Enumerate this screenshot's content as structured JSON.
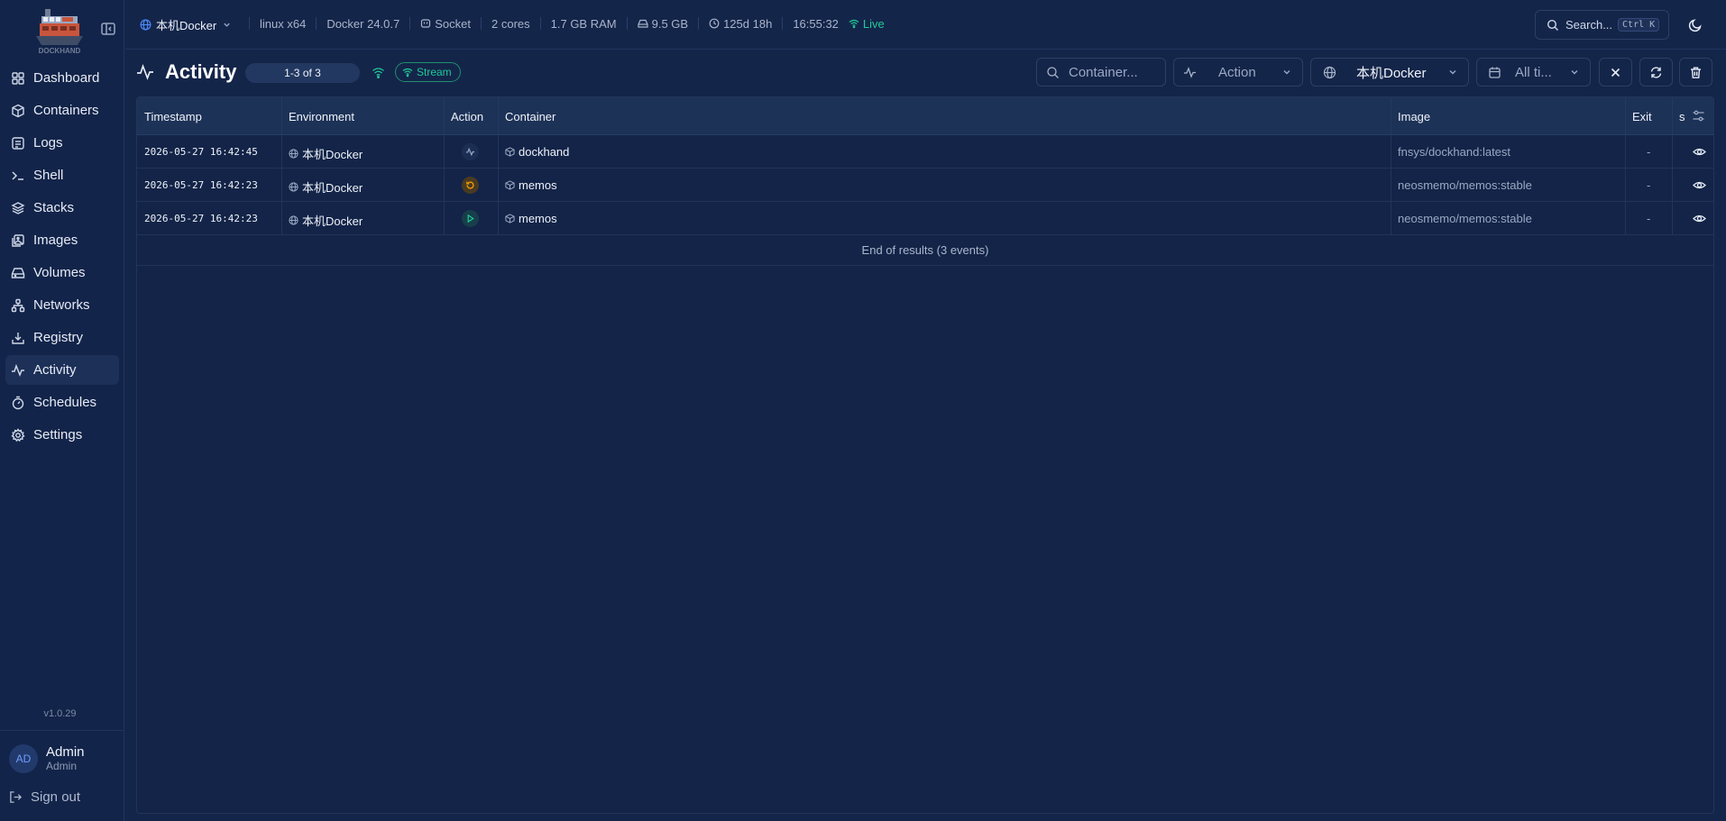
{
  "app": {
    "logo_text": "DOCKHAND",
    "version": "v1.0.29"
  },
  "sidebar": {
    "items": [
      {
        "label": "Dashboard",
        "icon": "dashboard-icon"
      },
      {
        "label": "Containers",
        "icon": "box-icon"
      },
      {
        "label": "Logs",
        "icon": "logs-icon"
      },
      {
        "label": "Shell",
        "icon": "terminal-icon"
      },
      {
        "label": "Stacks",
        "icon": "layers-icon"
      },
      {
        "label": "Images",
        "icon": "images-icon"
      },
      {
        "label": "Volumes",
        "icon": "hard-drive-icon"
      },
      {
        "label": "Networks",
        "icon": "network-icon"
      },
      {
        "label": "Registry",
        "icon": "download-icon"
      },
      {
        "label": "Activity",
        "icon": "activity-icon",
        "active": true
      },
      {
        "label": "Schedules",
        "icon": "timer-icon"
      },
      {
        "label": "Settings",
        "icon": "gear-icon"
      }
    ],
    "user": {
      "initials": "AD",
      "name": "Admin",
      "role": "Admin"
    },
    "signout_label": "Sign out"
  },
  "topbar": {
    "environment": "本机Docker",
    "stats": {
      "os": "linux x64",
      "docker": "Docker 24.0.7",
      "connection": "Socket",
      "cores": "2 cores",
      "ram": "1.7 GB RAM",
      "disk": "9.5 GB",
      "uptime": "125d 18h",
      "time": "16:55:32",
      "live": "Live"
    },
    "search_label": "Search...",
    "search_shortcut": "Ctrl K"
  },
  "page": {
    "title": "Activity",
    "count": "1-3 of 3",
    "stream_label": "Stream",
    "filters": {
      "container_placeholder": "Container...",
      "action": "Action",
      "environment": "本机Docker",
      "time": "All ti..."
    }
  },
  "table": {
    "headers": {
      "timestamp": "Timestamp",
      "environment": "Environment",
      "action": "Action",
      "container": "Container",
      "image": "Image",
      "exit": "Exit",
      "extra": "s"
    },
    "rows": [
      {
        "timestamp": "2026-05-27 16:42:45",
        "environment": "本机Docker",
        "action": "activity",
        "container": "dockhand",
        "image": "fnsys/dockhand:latest",
        "exit": "-"
      },
      {
        "timestamp": "2026-05-27 16:42:23",
        "environment": "本机Docker",
        "action": "restart",
        "container": "memos",
        "image": "neosmemo/memos:stable",
        "exit": "-"
      },
      {
        "timestamp": "2026-05-27 16:42:23",
        "environment": "本机Docker",
        "action": "start",
        "container": "memos",
        "image": "neosmemo/memos:stable",
        "exit": "-"
      }
    ],
    "end_text": "End of results (3 events)"
  },
  "colors": {
    "background": "#14254a",
    "accent_green": "#20c997",
    "accent_blue": "#4f8cff",
    "restart_orange": "#f59f00"
  }
}
